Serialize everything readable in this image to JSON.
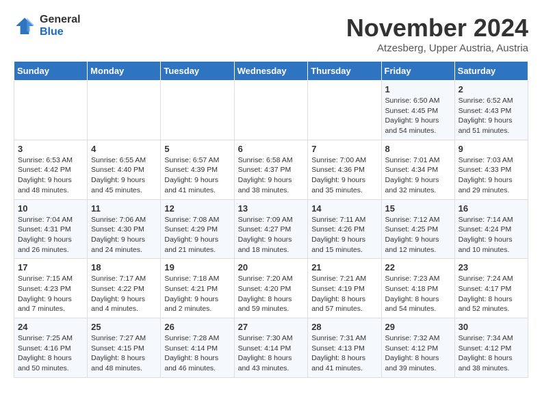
{
  "logo": {
    "general": "General",
    "blue": "Blue"
  },
  "title": "November 2024",
  "location": "Atzesberg, Upper Austria, Austria",
  "days_of_week": [
    "Sunday",
    "Monday",
    "Tuesday",
    "Wednesday",
    "Thursday",
    "Friday",
    "Saturday"
  ],
  "weeks": [
    [
      {
        "day": "",
        "info": ""
      },
      {
        "day": "",
        "info": ""
      },
      {
        "day": "",
        "info": ""
      },
      {
        "day": "",
        "info": ""
      },
      {
        "day": "",
        "info": ""
      },
      {
        "day": "1",
        "info": "Sunrise: 6:50 AM\nSunset: 4:45 PM\nDaylight: 9 hours and 54 minutes."
      },
      {
        "day": "2",
        "info": "Sunrise: 6:52 AM\nSunset: 4:43 PM\nDaylight: 9 hours and 51 minutes."
      }
    ],
    [
      {
        "day": "3",
        "info": "Sunrise: 6:53 AM\nSunset: 4:42 PM\nDaylight: 9 hours and 48 minutes."
      },
      {
        "day": "4",
        "info": "Sunrise: 6:55 AM\nSunset: 4:40 PM\nDaylight: 9 hours and 45 minutes."
      },
      {
        "day": "5",
        "info": "Sunrise: 6:57 AM\nSunset: 4:39 PM\nDaylight: 9 hours and 41 minutes."
      },
      {
        "day": "6",
        "info": "Sunrise: 6:58 AM\nSunset: 4:37 PM\nDaylight: 9 hours and 38 minutes."
      },
      {
        "day": "7",
        "info": "Sunrise: 7:00 AM\nSunset: 4:36 PM\nDaylight: 9 hours and 35 minutes."
      },
      {
        "day": "8",
        "info": "Sunrise: 7:01 AM\nSunset: 4:34 PM\nDaylight: 9 hours and 32 minutes."
      },
      {
        "day": "9",
        "info": "Sunrise: 7:03 AM\nSunset: 4:33 PM\nDaylight: 9 hours and 29 minutes."
      }
    ],
    [
      {
        "day": "10",
        "info": "Sunrise: 7:04 AM\nSunset: 4:31 PM\nDaylight: 9 hours and 26 minutes."
      },
      {
        "day": "11",
        "info": "Sunrise: 7:06 AM\nSunset: 4:30 PM\nDaylight: 9 hours and 24 minutes."
      },
      {
        "day": "12",
        "info": "Sunrise: 7:08 AM\nSunset: 4:29 PM\nDaylight: 9 hours and 21 minutes."
      },
      {
        "day": "13",
        "info": "Sunrise: 7:09 AM\nSunset: 4:27 PM\nDaylight: 9 hours and 18 minutes."
      },
      {
        "day": "14",
        "info": "Sunrise: 7:11 AM\nSunset: 4:26 PM\nDaylight: 9 hours and 15 minutes."
      },
      {
        "day": "15",
        "info": "Sunrise: 7:12 AM\nSunset: 4:25 PM\nDaylight: 9 hours and 12 minutes."
      },
      {
        "day": "16",
        "info": "Sunrise: 7:14 AM\nSunset: 4:24 PM\nDaylight: 9 hours and 10 minutes."
      }
    ],
    [
      {
        "day": "17",
        "info": "Sunrise: 7:15 AM\nSunset: 4:23 PM\nDaylight: 9 hours and 7 minutes."
      },
      {
        "day": "18",
        "info": "Sunrise: 7:17 AM\nSunset: 4:22 PM\nDaylight: 9 hours and 4 minutes."
      },
      {
        "day": "19",
        "info": "Sunrise: 7:18 AM\nSunset: 4:21 PM\nDaylight: 9 hours and 2 minutes."
      },
      {
        "day": "20",
        "info": "Sunrise: 7:20 AM\nSunset: 4:20 PM\nDaylight: 8 hours and 59 minutes."
      },
      {
        "day": "21",
        "info": "Sunrise: 7:21 AM\nSunset: 4:19 PM\nDaylight: 8 hours and 57 minutes."
      },
      {
        "day": "22",
        "info": "Sunrise: 7:23 AM\nSunset: 4:18 PM\nDaylight: 8 hours and 54 minutes."
      },
      {
        "day": "23",
        "info": "Sunrise: 7:24 AM\nSunset: 4:17 PM\nDaylight: 8 hours and 52 minutes."
      }
    ],
    [
      {
        "day": "24",
        "info": "Sunrise: 7:25 AM\nSunset: 4:16 PM\nDaylight: 8 hours and 50 minutes."
      },
      {
        "day": "25",
        "info": "Sunrise: 7:27 AM\nSunset: 4:15 PM\nDaylight: 8 hours and 48 minutes."
      },
      {
        "day": "26",
        "info": "Sunrise: 7:28 AM\nSunset: 4:14 PM\nDaylight: 8 hours and 46 minutes."
      },
      {
        "day": "27",
        "info": "Sunrise: 7:30 AM\nSunset: 4:14 PM\nDaylight: 8 hours and 43 minutes."
      },
      {
        "day": "28",
        "info": "Sunrise: 7:31 AM\nSunset: 4:13 PM\nDaylight: 8 hours and 41 minutes."
      },
      {
        "day": "29",
        "info": "Sunrise: 7:32 AM\nSunset: 4:12 PM\nDaylight: 8 hours and 39 minutes."
      },
      {
        "day": "30",
        "info": "Sunrise: 7:34 AM\nSunset: 4:12 PM\nDaylight: 8 hours and 38 minutes."
      }
    ]
  ]
}
